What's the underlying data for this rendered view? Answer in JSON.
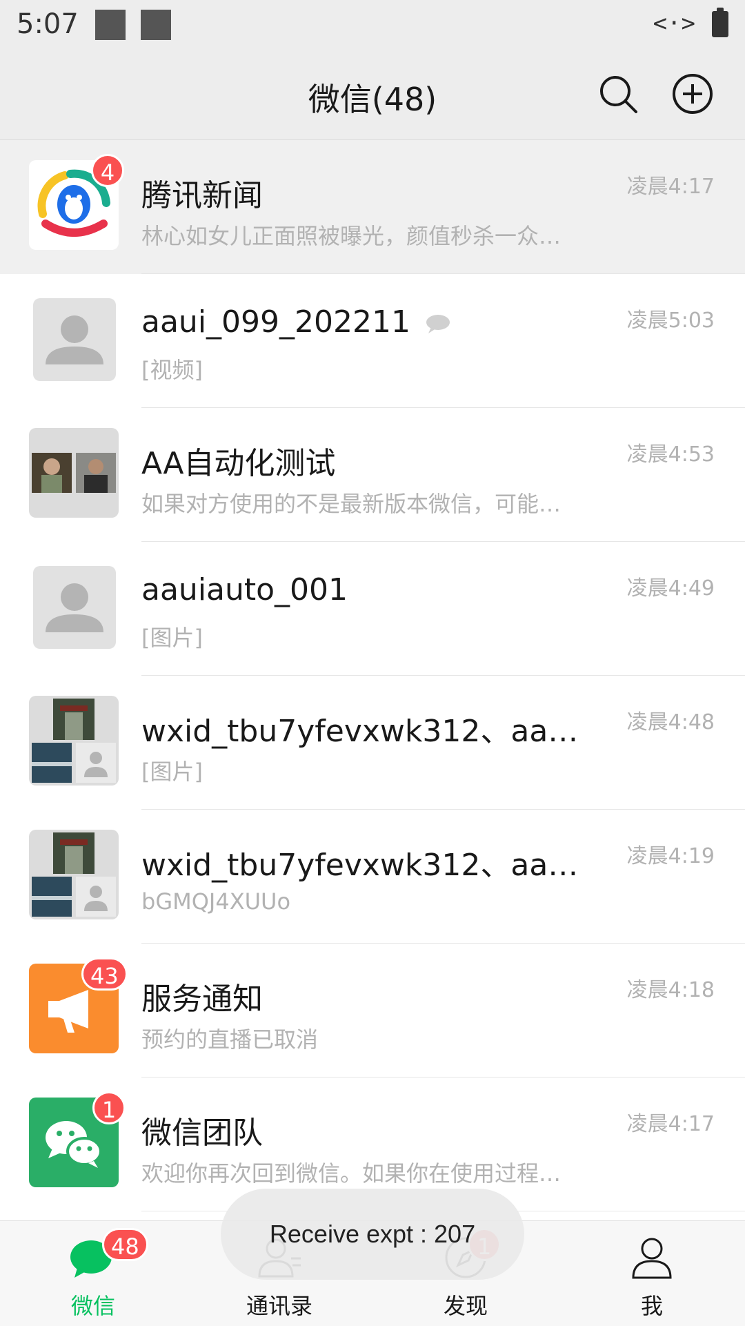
{
  "status_bar": {
    "time": "5:07",
    "network_glyph": "<·>"
  },
  "header": {
    "title": "微信(48)",
    "search_icon": "search-icon",
    "add_icon": "plus-circle-icon"
  },
  "chats": [
    {
      "name": "腾讯新闻",
      "preview": "林心如女儿正面照被曝光，颜值秒杀一众…",
      "time": "凌晨4:17",
      "badge": "4"
    },
    {
      "name": "aaui_099_202211",
      "preview": "[视频]",
      "time": "凌晨5:03"
    },
    {
      "name": "AA自动化测试",
      "preview": "如果对方使用的不是最新版本微信，可能…",
      "time": "凌晨4:53"
    },
    {
      "name": "aauiauto_001",
      "preview": "[图片]",
      "time": "凌晨4:49"
    },
    {
      "name": "wxid_tbu7yfevxwk312、aauia…",
      "preview": "[图片]",
      "time": "凌晨4:48"
    },
    {
      "name": "wxid_tbu7yfevxwk312、aauia…",
      "preview": "bGMQJ4XUUo",
      "time": "凌晨4:19"
    },
    {
      "name": "服务通知",
      "preview": "预约的直播已取消",
      "time": "凌晨4:18",
      "badge": "43"
    },
    {
      "name": "微信团队",
      "preview": "欢迎你再次回到微信。如果你在使用过程…",
      "time": "凌晨4:17",
      "badge": "1"
    }
  ],
  "tabs": [
    {
      "label": "微信",
      "badge": "48"
    },
    {
      "label": "通讯录"
    },
    {
      "label": "发现",
      "badge": "1"
    },
    {
      "label": "我"
    }
  ],
  "toast": {
    "text": "Receive expt : 207"
  },
  "colors": {
    "accent": "#07c160",
    "badge": "#fa5151",
    "service_orange": "#fa8c2e",
    "wechat_green": "#2aae67"
  }
}
